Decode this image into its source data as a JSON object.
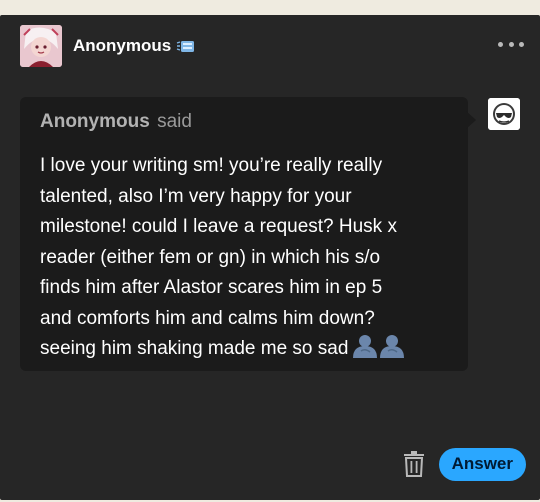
{
  "post": {
    "blog_name": "Anonymous",
    "blog_badge_icon": "blue-sticker-badge-icon",
    "more_icon": "more-horizontal-icon"
  },
  "ask": {
    "asker_name": "Anonymous",
    "said_text": "said",
    "asker_avatar_icon": "anonymous-sunglasses-avatar",
    "question_lines": [
      "I love your writing sm! you’re really really",
      "talented, also I’m very happy for your",
      "milestone! could I leave a request? Husk x",
      "reader (either fem or gn) in which his s/o",
      "finds him after Alastor scares him in ep 5",
      "and comforts him and calms him down?",
      "seeing him shaking made me so sad"
    ],
    "trailing_emoji": "people-hugging-emoji"
  },
  "actions": {
    "delete_icon": "trash-icon",
    "answer_label": "Answer"
  },
  "colors": {
    "card_background": "#262626",
    "bubble_background": "#1b1b1b",
    "accent_blue": "#2aa7ff",
    "page_background": "#efebe0"
  }
}
